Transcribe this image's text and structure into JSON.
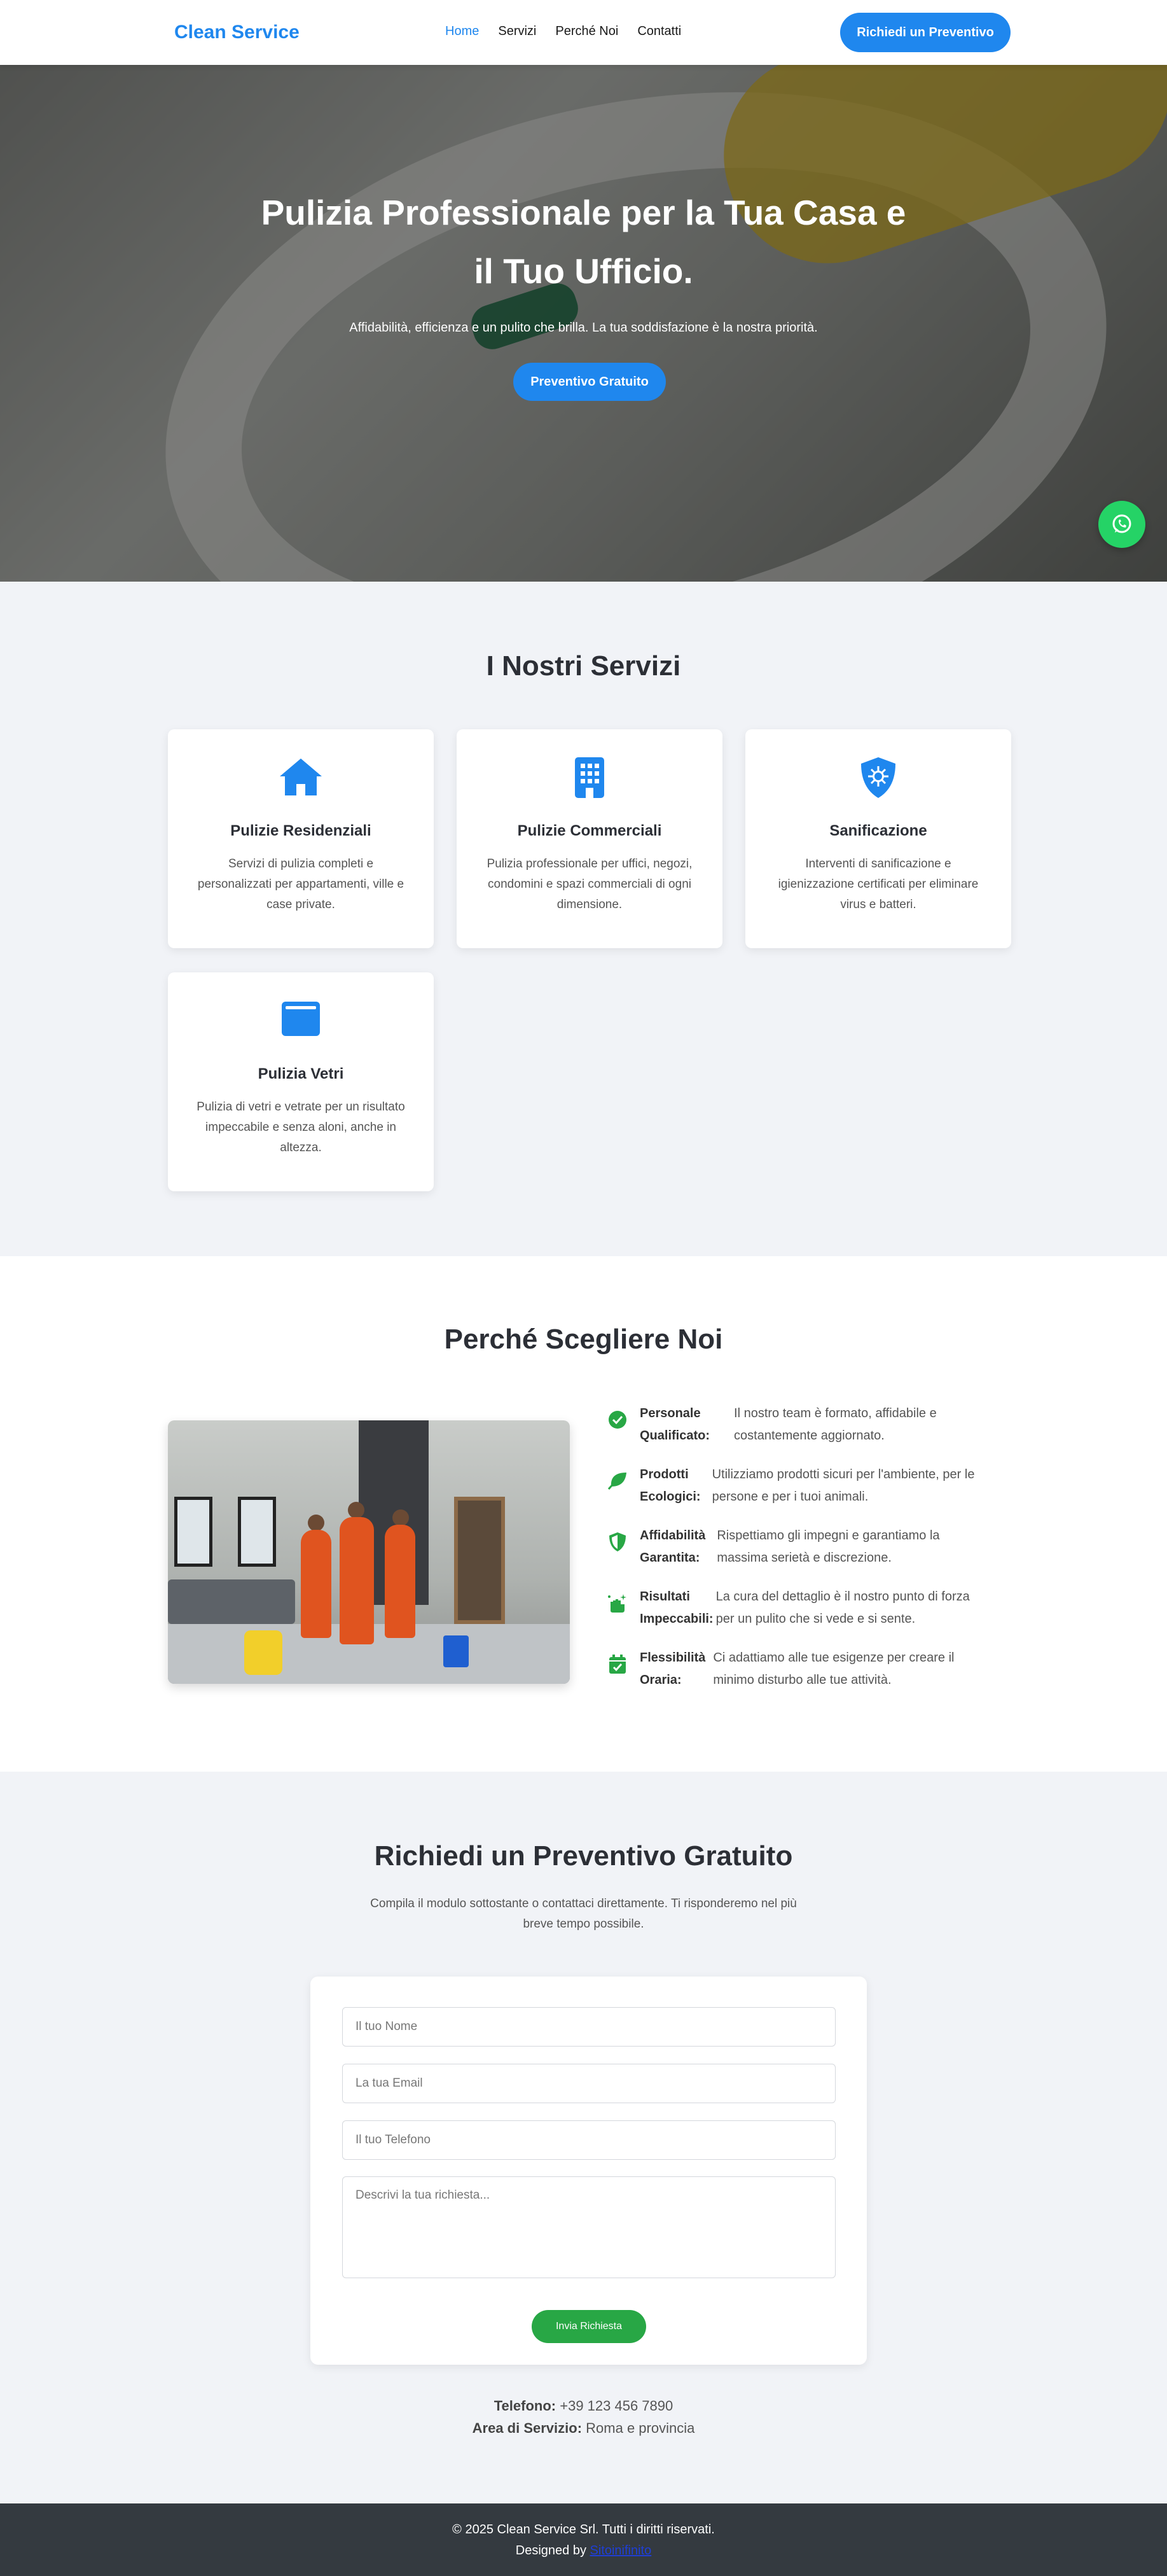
{
  "nav": {
    "logo": "Clean Service",
    "links": [
      "Home",
      "Servizi",
      "Perché Noi",
      "Contatti"
    ],
    "cta": "Richiedi un Preventivo"
  },
  "hero": {
    "title_line1": "Pulizia Professionale per la Tua Casa e",
    "title_line2": "il Tuo Ufficio.",
    "subtitle": "Affidabilità, efficienza e un pulito che brilla. La tua soddisfazione è la nostra priorità.",
    "button": "Preventivo Gratuito"
  },
  "whatsapp": {
    "icon": "whatsapp-icon"
  },
  "services": {
    "title": "I Nostri Servizi",
    "cards": [
      {
        "icon": "house-icon",
        "title": "Pulizie Residenziali",
        "text": "Servizi di pulizia completi e personalizzati per appartamenti, ville e case private."
      },
      {
        "icon": "building-icon",
        "title": "Pulizie Commerciali",
        "text": "Pulizia professionale per uffici, negozi, condomini e spazi commerciali di ogni dimensione."
      },
      {
        "icon": "shield-virus-icon",
        "title": "Sanificazione",
        "text": "Interventi di sanificazione e igienizzazione certificati per eliminare virus e batteri."
      },
      {
        "icon": "window-icon",
        "title": "Pulizia Vetri",
        "text": "Pulizia di vetri e vetrate per un risultato impeccabile e senza aloni, anche in altezza."
      }
    ]
  },
  "why": {
    "title": "Perché Scegliere Noi",
    "features": [
      {
        "icon": "check-circle-icon",
        "name1": "Personale",
        "name2": "Qualificato:",
        "d1": "Il nostro team è formato, affidabile e",
        "d2": "costantemente aggiornato."
      },
      {
        "icon": "leaf-icon",
        "name1": "Prodotti",
        "name2": "Ecologici:",
        "d1": "Utilizziamo prodotti sicuri per l'ambiente, per le",
        "d2": "persone e per i tuoi animali."
      },
      {
        "icon": "shield-icon",
        "name1": "Affidabilità",
        "name2": "Garantita:",
        "d1": "Rispettiamo gli impegni e garantiamo la",
        "d2": "massima serietà e discrezione."
      },
      {
        "icon": "sparkle-hand-icon",
        "name1": "Risultati",
        "name2": "Impeccabili:",
        "d1": "La cura del dettaglio è il nostro punto di forza",
        "d2": "per un pulito che si vede e si sente."
      },
      {
        "icon": "calendar-check-icon",
        "name1": "Flessibilità",
        "name2": "Oraria:",
        "d1": "Ci adattiamo alle tue esigenze per creare il",
        "d2": "minimo disturbo alle tue attività."
      }
    ]
  },
  "quote": {
    "title": "Richiedi un Preventivo Gratuito",
    "subtitle_line1": "Compila il modulo sottostante o contattaci direttamente. Ti risponderemo nel più",
    "subtitle_line2": "breve tempo possibile.",
    "form": {
      "name_placeholder": "Il tuo Nome",
      "email_placeholder": "La tua Email",
      "phone_placeholder": "Il tuo Telefono",
      "message_placeholder": "Descrivi la tua richiesta...",
      "submit": "Invia Richiesta"
    },
    "phone_label": "Telefono:",
    "phone_value": "+39 123 456 7890",
    "area_label": "Area di Servizio:",
    "area_value": "Roma e provincia"
  },
  "footer": {
    "copyright": "© 2025 Clean Service Srl. Tutti i diritti riservati.",
    "designed_by": "Designed by",
    "designer_link": "Sitoinifinito"
  },
  "colors": {
    "accent": "#1f87ee",
    "green": "#28a745",
    "whatsapp": "#25d366",
    "footer": "#343a40",
    "section_bg": "#f1f3f7"
  }
}
